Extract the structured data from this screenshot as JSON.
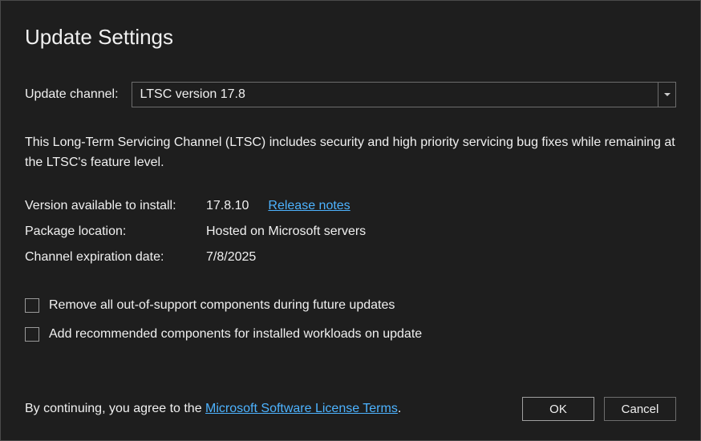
{
  "title": "Update Settings",
  "channel": {
    "label": "Update channel:",
    "selected": "LTSC version 17.8"
  },
  "description": "This Long-Term Servicing Channel (LTSC) includes security and high priority servicing bug fixes while remaining at the LTSC's feature level.",
  "info": {
    "version_label": "Version available to install:",
    "version_value": "17.8.10",
    "release_notes": "Release notes",
    "package_label": "Package location:",
    "package_value": "Hosted on Microsoft servers",
    "expiration_label": "Channel expiration date:",
    "expiration_value": "7/8/2025"
  },
  "checkboxes": {
    "remove_unsupported": "Remove all out-of-support components during future updates",
    "add_recommended": "Add recommended components for installed workloads on update"
  },
  "footer": {
    "prefix": "By continuing, you agree to the ",
    "link": "Microsoft Software License Terms",
    "suffix": ".",
    "ok": "OK",
    "cancel": "Cancel"
  }
}
